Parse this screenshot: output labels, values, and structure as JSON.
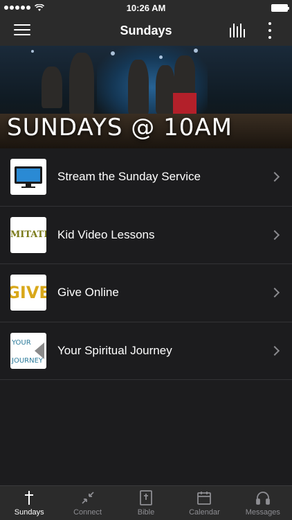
{
  "status_bar": {
    "time": "10:26 AM"
  },
  "nav": {
    "title": "Sundays"
  },
  "hero": {
    "title": "SUNDAYS @ 10AM"
  },
  "list": [
    {
      "label": "Stream the Sunday Service",
      "icon": "tv-icon"
    },
    {
      "label": "Kid Video Lessons",
      "icon": "imitate-logo",
      "thumb_text": "IMITATE"
    },
    {
      "label": "Give Online",
      "icon": "give-logo",
      "thumb_text": "GIVE"
    },
    {
      "label": "Your Spiritual Journey",
      "icon": "journey-logo",
      "thumb_text_1": "YOUR",
      "thumb_text_2": "JOURNEY"
    }
  ],
  "tabs": [
    {
      "label": "Sundays",
      "icon": "cross-icon",
      "active": true
    },
    {
      "label": "Connect",
      "icon": "compress-arrows-icon",
      "active": false
    },
    {
      "label": "Bible",
      "icon": "bible-icon",
      "active": false
    },
    {
      "label": "Calendar",
      "icon": "calendar-icon",
      "active": false
    },
    {
      "label": "Messages",
      "icon": "headphones-icon",
      "active": false
    }
  ],
  "colors": {
    "background": "#1c1c1e",
    "bar": "#2b2b2b",
    "active_tab": "#ffffff",
    "inactive_tab": "#8e8e93"
  }
}
